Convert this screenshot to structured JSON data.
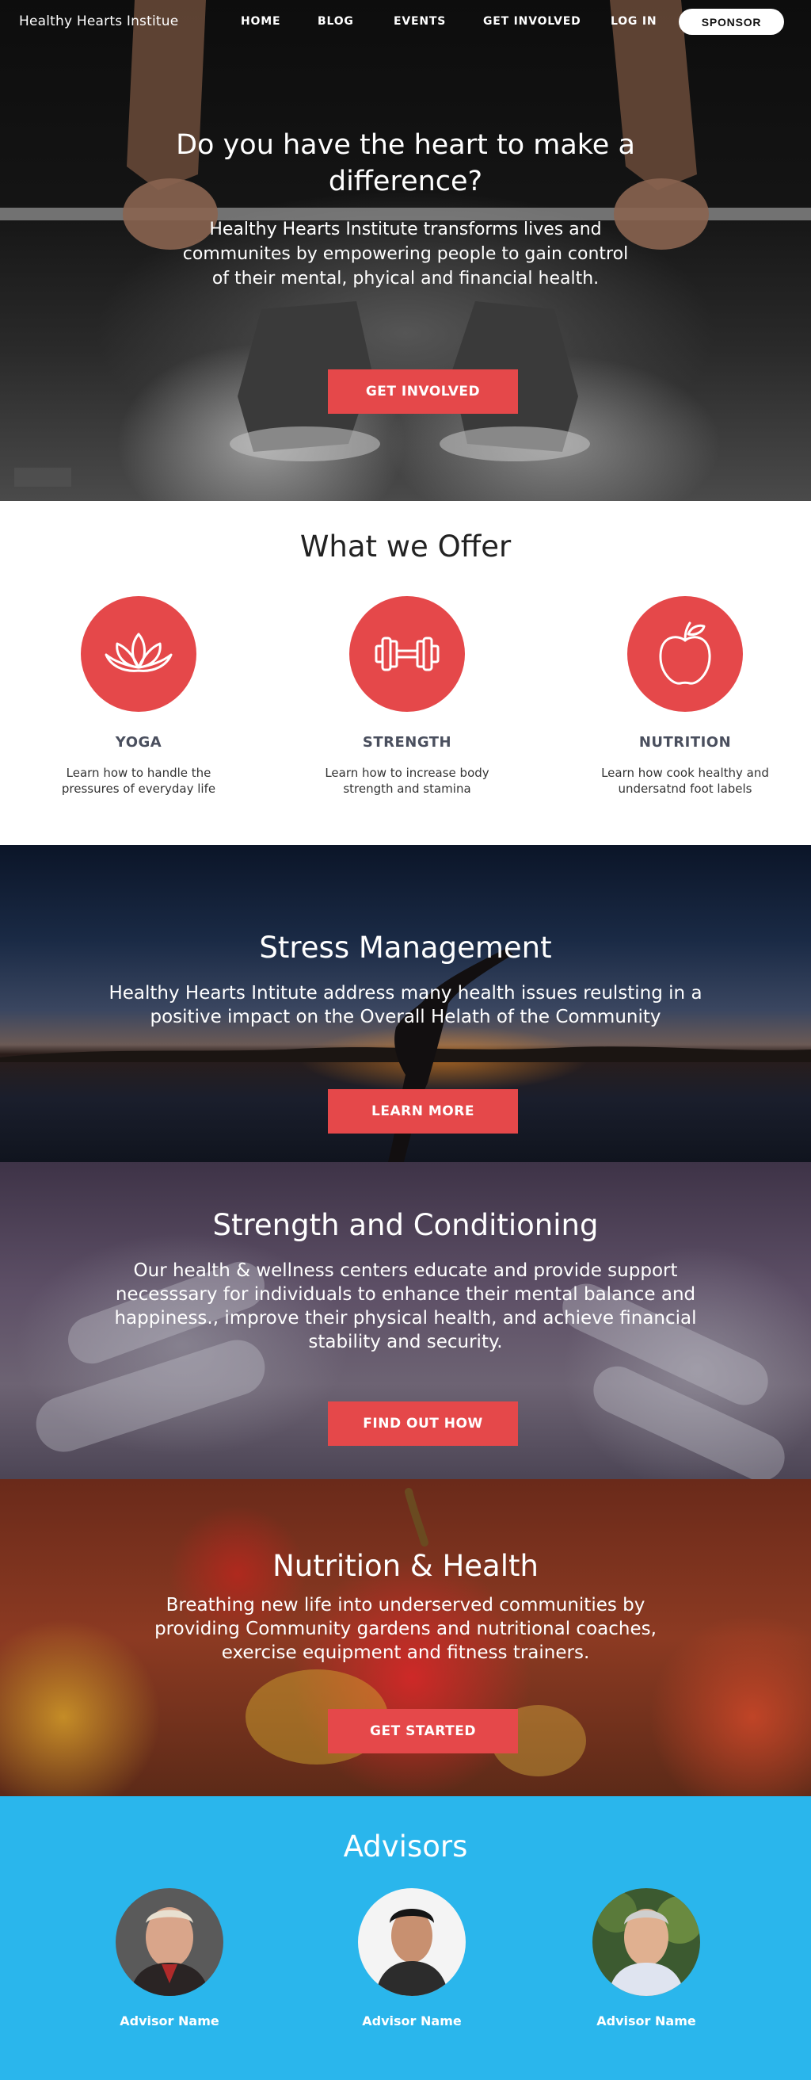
{
  "nav": {
    "brand": "Healthy Hearts Institue",
    "links": [
      "HOME",
      "BLOG",
      "EVENTS",
      "GET INVOLVED",
      "LOG IN"
    ],
    "sponsor_label": "SPONSOR"
  },
  "hero": {
    "title": "Do you have the heart to make a difference?",
    "text": "Healthy Hearts Institute transforms lives and communites by empowering people to gain control of their mental, phyical and financial health.",
    "cta": "GET INVOLVED"
  },
  "offer": {
    "title": "What we Offer",
    "items": [
      {
        "icon": "lotus-icon",
        "label": "YOGA",
        "desc": "Learn how to handle the pressures of everyday life"
      },
      {
        "icon": "dumbbell-icon",
        "label": "STRENGTH",
        "desc": "Learn how to increase body strength and stamina"
      },
      {
        "icon": "apple-icon",
        "label": "NUTRITION",
        "desc": "Learn how cook healthy and undersatnd foot labels"
      }
    ]
  },
  "stress": {
    "title": "Stress Management",
    "text": "Healthy Hearts Intitute address many health issues reulsting in a positive impact on the Overall Helath of the Community",
    "cta": "LEARN MORE"
  },
  "strength": {
    "title": "Strength and Conditioning",
    "text": "Our health & wellness centers educate and provide support necesssary for individuals to enhance their mental balance and happiness., improve their physical health, and achieve financial stability and security.",
    "cta": "FIND OUT HOW"
  },
  "nutrition": {
    "title": "Nutrition & Health",
    "text": "Breathing new life into underserved communities by providing Community gardens and nutritional coaches, exercise equipment and fitness trainers.",
    "cta": "GET STARTED"
  },
  "advisors": {
    "title": "Advisors",
    "people": [
      {
        "name": "Advisor Name"
      },
      {
        "name": "Advisor Name"
      },
      {
        "name": "Advisor Name"
      }
    ]
  },
  "colors": {
    "accent": "#e5484a",
    "advisors_bg": "#2ab6ec",
    "heading_gray": "#4a4f5e"
  }
}
